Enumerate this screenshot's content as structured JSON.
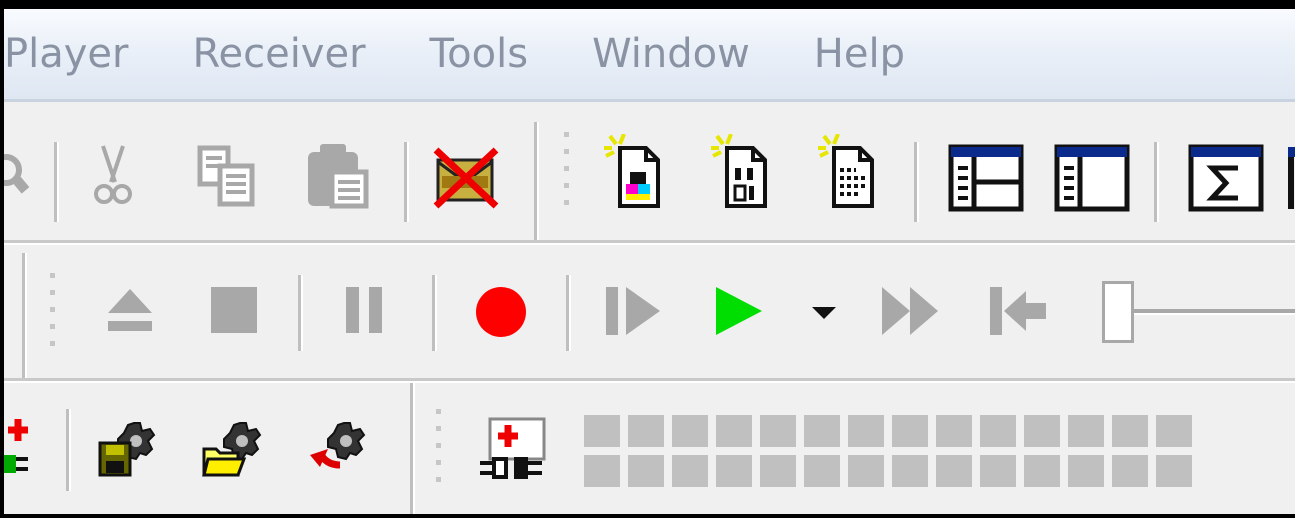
{
  "menubar": {
    "items": [
      "Player",
      "Receiver",
      "Tools",
      "Window",
      "Help"
    ]
  },
  "toolbar1": {
    "icons": [
      "find-icon",
      "cut-icon",
      "copy-icon",
      "paste-icon",
      "delete-icon",
      "new-image-file-icon",
      "new-binary-file-icon",
      "new-text-file-icon",
      "split-view-icon",
      "side-panel-icon",
      "sum-icon"
    ]
  },
  "toolbar2": {
    "icons": [
      "eject-icon",
      "stop-icon",
      "pause-icon",
      "record-icon",
      "step-icon",
      "play-icon",
      "play-options-dropdown-icon",
      "fast-forward-icon",
      "rewind-to-start-icon"
    ],
    "colors": {
      "record": "#ff0000",
      "play": "#00dd00"
    }
  },
  "toolbar3": {
    "icons": [
      "add-plugin-icon",
      "save-config-icon",
      "open-config-icon",
      "revert-config-icon",
      "add-device-icon"
    ],
    "indicator_count": 28
  },
  "colors": {
    "menu_text": "#8a93a3",
    "disabled_icon": "#a8a8a8"
  }
}
